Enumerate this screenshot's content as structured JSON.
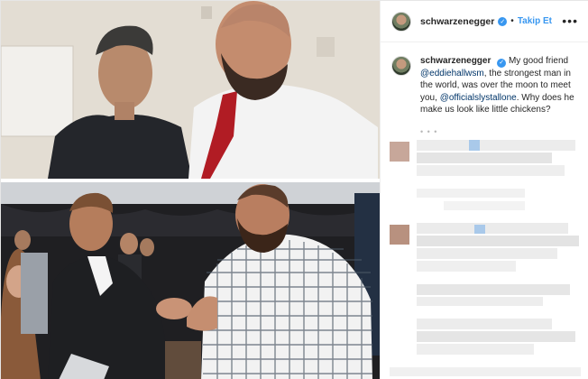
{
  "header": {
    "username": "schwarzenegger",
    "separator": "•",
    "follow_label": "Takip Et",
    "more_icon": "more-options-icon"
  },
  "caption": {
    "username": "schwarzenegger",
    "text_part1": "My good friend ",
    "mention1": "@eddiehallwsm",
    "text_part2": ", the strongest man in the world, was over the moon to meet you, ",
    "mention2": "@officialslystallone",
    "text_part3": ". Why does he make us look like little chickens?",
    "time_blurred": "• • •"
  },
  "colors": {
    "link": "#3897f0",
    "mention": "#003569",
    "verified": "#3897f0",
    "text": "#262626",
    "border": "#efefef"
  }
}
